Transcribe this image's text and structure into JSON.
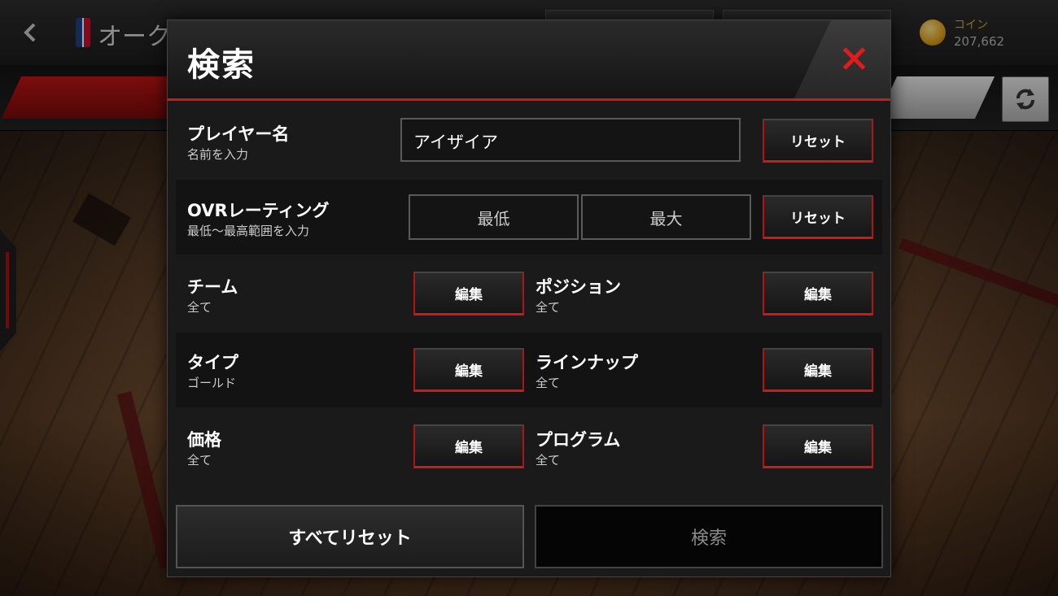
{
  "background": {
    "screen_title": "オーク",
    "coin_label": "コイン",
    "coin_value": "207,662"
  },
  "dialog": {
    "title": "検索",
    "player_name": {
      "label": "プレイヤー名",
      "sub": "名前を入力",
      "value": "アイザイア",
      "reset": "リセット"
    },
    "ovr": {
      "label": "OVRレーティング",
      "sub": "最低～最高範囲を入力",
      "min_placeholder": "最低",
      "max_placeholder": "最大",
      "reset": "リセット"
    },
    "filters": [
      {
        "label": "チーム",
        "sub": "全て",
        "button": "編集"
      },
      {
        "label": "ポジション",
        "sub": "全て",
        "button": "編集"
      },
      {
        "label": "タイプ",
        "sub": "ゴールド",
        "button": "編集"
      },
      {
        "label": "ラインナップ",
        "sub": "全て",
        "button": "編集"
      },
      {
        "label": "価格",
        "sub": "全て",
        "button": "編集"
      },
      {
        "label": "プログラム",
        "sub": "全て",
        "button": "編集"
      }
    ],
    "reset_all": "すべてリセット",
    "search": "検索"
  },
  "colors": {
    "accent": "#d01818",
    "close": "#e21b1b",
    "coin": "#e0a21a"
  }
}
